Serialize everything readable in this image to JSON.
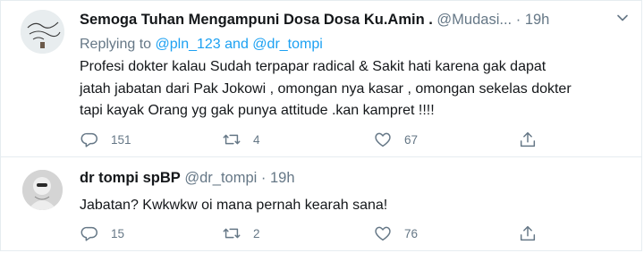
{
  "tweets": [
    {
      "name": "Semoga Tuhan Mengampuni Dosa Dosa Ku.Amin .",
      "handle": "@Mudasi...",
      "separator": "·",
      "time": "19h",
      "replying_prefix": "Replying to",
      "replying_to": [
        "@pln_123",
        "@dr_tompi"
      ],
      "replying_and": "and",
      "text_lines": [
        "Profesi dokter kalau Sudah terpapar radical & Sakit hati karena gak dapat",
        "jatah jabatan dari Pak Jokowi , omongan nya kasar , omongan sekelas dokter",
        "tapi kayak Orang yg gak punya attitude .kan kampret !!!!"
      ],
      "replies": "151",
      "retweets": "4",
      "likes": "67"
    },
    {
      "name": "dr tompi spBP",
      "handle": "@dr_tompi",
      "separator": "·",
      "time": "19h",
      "text_lines": [
        "Jabatan? Kwkwkw oi mana pernah kearah sana!"
      ],
      "replies": "15",
      "retweets": "2",
      "likes": "76"
    }
  ],
  "icons": {
    "reply": "reply-icon",
    "retweet": "retweet-icon",
    "like": "heart-icon",
    "share": "share-icon",
    "more": "chevron-down-icon"
  },
  "colors": {
    "link": "#1da1f2",
    "muted": "#657786",
    "text": "#14171a",
    "border": "#e6ecf0"
  }
}
